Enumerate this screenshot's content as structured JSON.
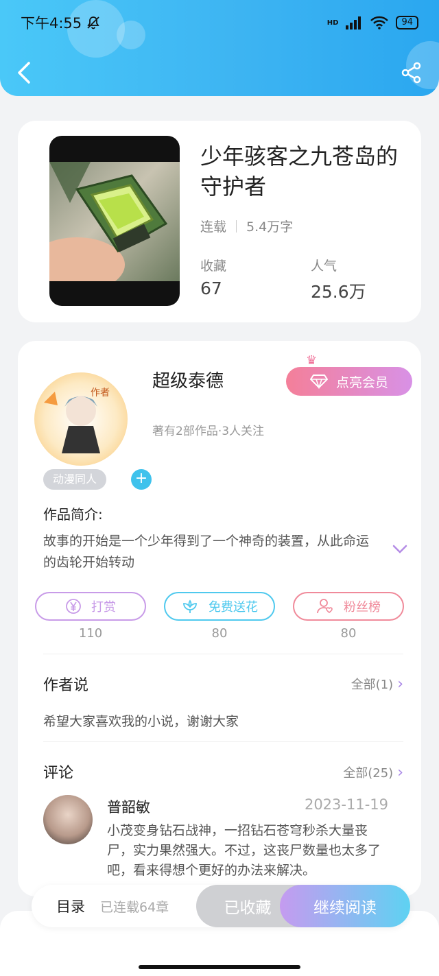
{
  "status_bar": {
    "time": "下午4:55",
    "network": "HD",
    "battery": "94"
  },
  "book": {
    "title": "少年骇客之九苍岛的守护者",
    "status": "连载",
    "word_count": "5.4万字",
    "collect_label": "收藏",
    "collect_value": "67",
    "popularity_label": "人气",
    "popularity_value": "25.6万"
  },
  "author": {
    "badge": "作者",
    "name": "超级泰德",
    "meta": "著有2部作品·3人关注",
    "vip_label": "点亮会员"
  },
  "tags": [
    "动漫同人"
  ],
  "intro": {
    "label": "作品简介:",
    "text": "故事的开始是一个少年得到了一个神奇的装置，从此命运的齿轮开始转动"
  },
  "actions": [
    {
      "label": "打赏",
      "count": "110",
      "color": "#c89be8"
    },
    {
      "label": "免费送花",
      "count": "80",
      "color": "#4fc9ee"
    },
    {
      "label": "粉丝榜",
      "count": "80",
      "color": "#f08a9a"
    }
  ],
  "author_says": {
    "title": "作者说",
    "more": "全部(1)",
    "text": "希望大家喜欢我的小说，谢谢大家"
  },
  "comments": {
    "title": "评论",
    "more": "全部(25)",
    "items": [
      {
        "user": "普韶敏",
        "date": "2023-11-19",
        "text": "小茂变身钻石战神，一招钻石苍穹秒杀大量丧尸，实力果然强大。不过，这丧尸数量也太多了吧，看来得想个更好的办法来解决。"
      }
    ]
  },
  "bottom": {
    "toc": "目录",
    "chapters": "已连载64章",
    "collected": "已收藏",
    "read": "继续阅读"
  },
  "colors": {
    "header": "#3db4f2",
    "accent": "#a885e6",
    "vip": "#f47f99"
  }
}
